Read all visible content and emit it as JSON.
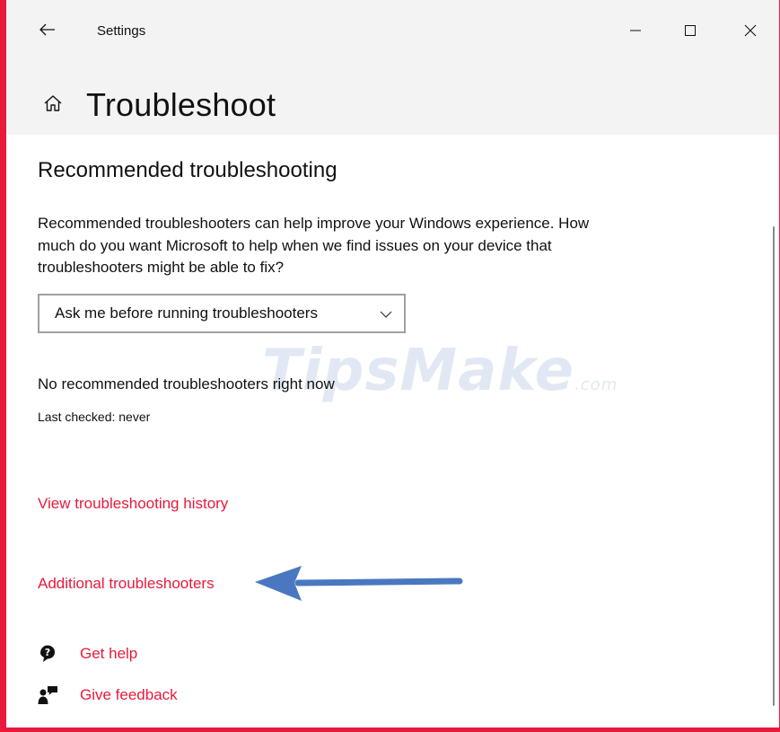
{
  "window": {
    "title": "Settings",
    "minimize_glyph": "—",
    "maximize_glyph": "☐",
    "close_glyph": "✕"
  },
  "page": {
    "title": "Troubleshoot"
  },
  "section": {
    "title": "Recommended troubleshooting",
    "description": "Recommended troubleshooters can help improve your Windows experience. How much do you want Microsoft to help when we find issues on your device that troubleshooters might be able to fix?"
  },
  "dropdown": {
    "selected": "Ask me before running troubleshooters"
  },
  "status": {
    "message": "No recommended troubleshooters right now",
    "last_checked": "Last checked: never"
  },
  "links": {
    "history": "View troubleshooting history",
    "additional": "Additional troubleshooters",
    "get_help": "Get help",
    "give_feedback": "Give feedback"
  },
  "watermark": {
    "text": "TipsMake",
    "suffix": ".com"
  },
  "colors": {
    "accent": "#e81a3b",
    "annotation_arrow": "#4a78c0",
    "header_bg": "#f3f3f3"
  }
}
